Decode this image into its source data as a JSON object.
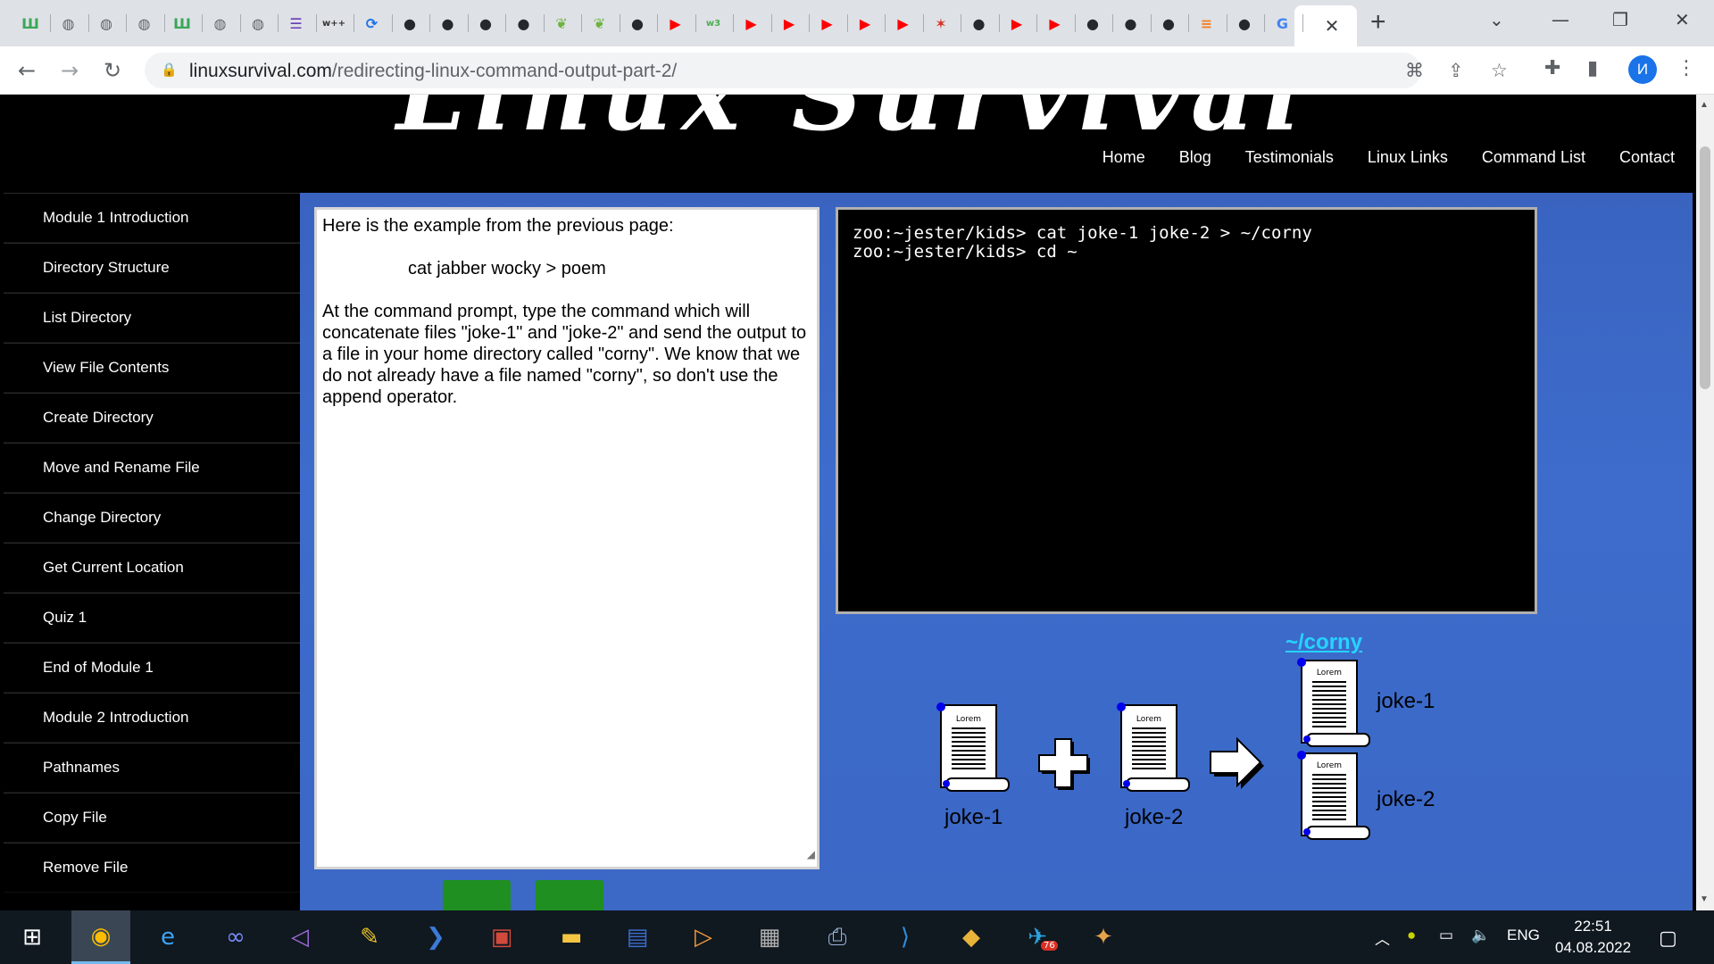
{
  "browser": {
    "tab_favicons": [
      {
        "name": "tab-coding-site",
        "glyph": "Ш",
        "color": "#3aa757"
      },
      {
        "name": "tab-globe",
        "glyph": "◍",
        "color": "#5f6368"
      },
      {
        "name": "tab-globe",
        "glyph": "◍",
        "color": "#5f6368"
      },
      {
        "name": "tab-globe",
        "glyph": "◍",
        "color": "#5f6368"
      },
      {
        "name": "tab-coding-site",
        "glyph": "Ш",
        "color": "#3aa757"
      },
      {
        "name": "tab-globe",
        "glyph": "◍",
        "color": "#5f6368"
      },
      {
        "name": "tab-globe",
        "glyph": "◍",
        "color": "#5f6368"
      },
      {
        "name": "tab-list",
        "glyph": "☰",
        "color": "#673ab7"
      },
      {
        "name": "tab-wpp",
        "glyph": "w++",
        "color": "#333333"
      },
      {
        "name": "tab-sync",
        "glyph": "⟳",
        "color": "#1a73e8"
      },
      {
        "name": "tab-github",
        "glyph": "●",
        "color": "#24292e"
      },
      {
        "name": "tab-github",
        "glyph": "●",
        "color": "#24292e"
      },
      {
        "name": "tab-github",
        "glyph": "●",
        "color": "#24292e"
      },
      {
        "name": "tab-github",
        "glyph": "●",
        "color": "#24292e"
      },
      {
        "name": "tab-leaf",
        "glyph": "❦",
        "color": "#6db33f"
      },
      {
        "name": "tab-leaf",
        "glyph": "❦",
        "color": "#6db33f"
      },
      {
        "name": "tab-github",
        "glyph": "●",
        "color": "#24292e"
      },
      {
        "name": "tab-youtube",
        "glyph": "▶",
        "color": "#ff0000"
      },
      {
        "name": "tab-w3",
        "glyph": "w3",
        "color": "#4caf50"
      },
      {
        "name": "tab-youtube",
        "glyph": "▶",
        "color": "#ff0000"
      },
      {
        "name": "tab-youtube",
        "glyph": "▶",
        "color": "#ff0000"
      },
      {
        "name": "tab-youtube",
        "glyph": "▶",
        "color": "#ff0000"
      },
      {
        "name": "tab-youtube",
        "glyph": "▶",
        "color": "#ff0000"
      },
      {
        "name": "tab-youtube",
        "glyph": "▶",
        "color": "#ff0000"
      },
      {
        "name": "tab-figure",
        "glyph": "✶",
        "color": "#d93025"
      },
      {
        "name": "tab-github",
        "glyph": "●",
        "color": "#24292e"
      },
      {
        "name": "tab-youtube",
        "glyph": "▶",
        "color": "#ff0000"
      },
      {
        "name": "tab-youtube",
        "glyph": "▶",
        "color": "#ff0000"
      },
      {
        "name": "tab-github",
        "glyph": "●",
        "color": "#24292e"
      },
      {
        "name": "tab-github",
        "glyph": "●",
        "color": "#24292e"
      },
      {
        "name": "tab-github",
        "glyph": "●",
        "color": "#24292e"
      },
      {
        "name": "tab-stackoverflow",
        "glyph": "≡",
        "color": "#f48024"
      },
      {
        "name": "tab-github",
        "glyph": "●",
        "color": "#24292e"
      },
      {
        "name": "tab-google",
        "glyph": "G",
        "color": "#4285f4"
      }
    ],
    "active_tab_close": "✕",
    "new_tab": "+",
    "window_controls": {
      "tab_search": "⌄",
      "minimize": "—",
      "restore": "❐",
      "close": "✕"
    },
    "url_host": "linuxsurvival.com",
    "url_path": "/redirecting-linux-command-output-part-2/",
    "profile_initial": "И"
  },
  "site": {
    "logo_text": "Linux Survival",
    "nav": [
      "Home",
      "Blog",
      "Testimonials",
      "Linux Links",
      "Command List",
      "Contact"
    ]
  },
  "sidebar": {
    "items": [
      "Module 1 Introduction",
      "Directory Structure",
      "List Directory",
      "View File Contents",
      "Create Directory",
      "Move and Rename File",
      "Change Directory",
      "Get Current Location",
      "Quiz 1",
      "End of Module 1",
      "Module 2 Introduction",
      "Pathnames",
      "Copy File",
      "Remove File"
    ]
  },
  "lesson": {
    "intro": "Here is the example from the previous page:",
    "example_cmd": "cat jabber wocky > poem",
    "instructions": "At the command prompt, type the command which will concatenate files \"joke-1\" and \"joke-2\" and send the output to a file in your home directory called \"corny\". We know that we do not already have a file named \"corny\", so don't use the append operator."
  },
  "terminal": {
    "lines": [
      "zoo:~jester/kids> cat joke-1 joke-2 > ~/corny",
      "zoo:~jester/kids> cd ~"
    ]
  },
  "illustration": {
    "target_label": "~/corny",
    "scroll_label": "Lorem",
    "file_a": "joke-1",
    "file_b": "joke-2",
    "result_a": "joke-1",
    "result_b": "joke-2"
  },
  "taskbar": {
    "language": "ENG",
    "time": "22:51",
    "date": "04.08.2022",
    "telegram_badge": "76"
  }
}
